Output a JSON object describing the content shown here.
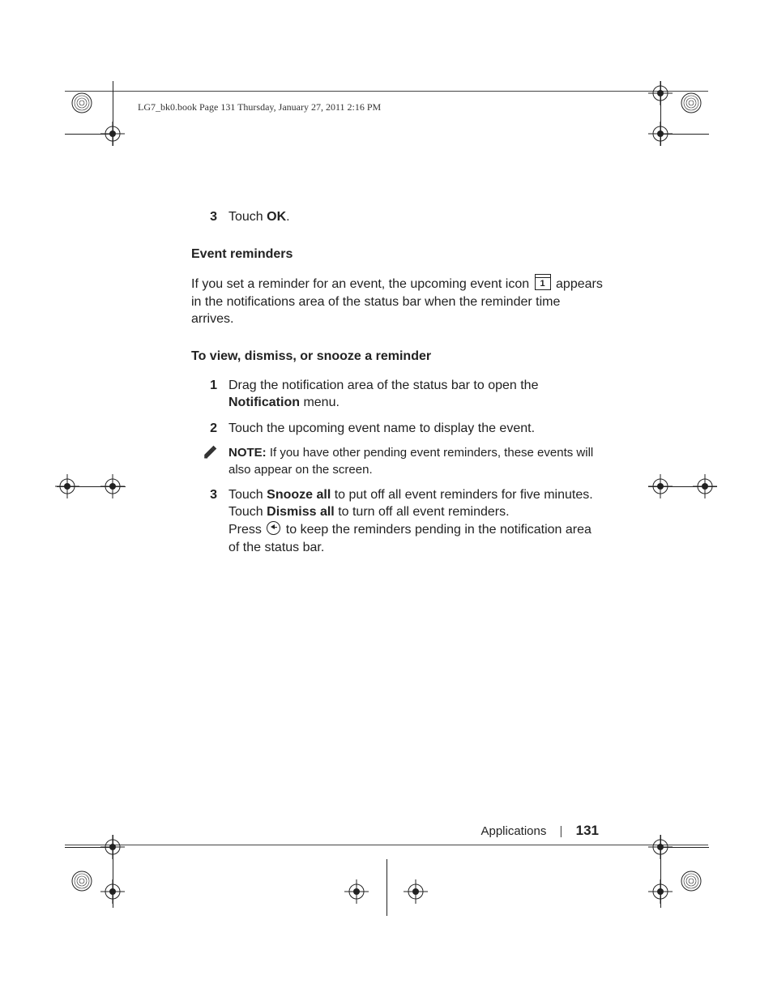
{
  "header_path": "LG7_bk0.book  Page 131  Thursday, January 27, 2011  2:16 PM",
  "step3_prefix": "Touch ",
  "step3_bold": "OK",
  "step3_suffix": ".",
  "h_event_reminders": "Event reminders",
  "para1_a": "If you set a reminder for an event, the upcoming event icon ",
  "para1_b": " appears in the notifications area of the status bar when the reminder time arrives.",
  "calendar_icon_num": "1",
  "h_view_dismiss": "To view, dismiss, or snooze a reminder",
  "s1_a": "Drag the notification area of the status bar to open the ",
  "s1_bold": "Notification",
  "s1_b": " menu.",
  "s2": "Touch the upcoming event name to display the event.",
  "note_bold": "NOTE:",
  "note_text": " If you have other pending event reminders, these events will also appear on the screen.",
  "s3_a": "Touch ",
  "s3_b1": "Snooze all",
  "s3_c": " to put off all event reminders for five minutes.",
  "s3_d": "Touch ",
  "s3_b2": "Dismiss all",
  "s3_e": " to turn off all event reminders.",
  "s3_f": "Press ",
  "s3_g": " to keep the reminders pending in the notification area of the status bar.",
  "footer_section": "Applications",
  "footer_page": "131",
  "nums": {
    "n3a": "3",
    "n1": "1",
    "n2": "2",
    "n3b": "3"
  }
}
